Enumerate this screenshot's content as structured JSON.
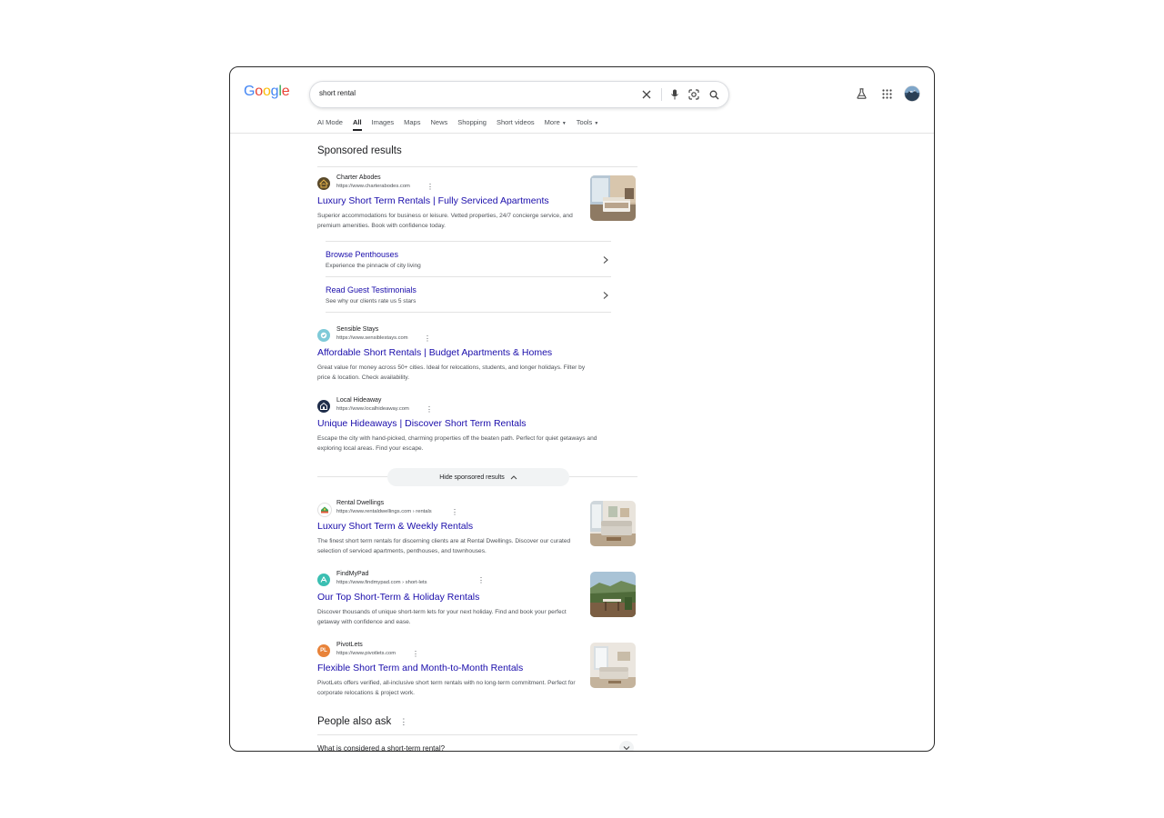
{
  "search": {
    "query": "short rental"
  },
  "logo": {
    "letters": [
      "G",
      "o",
      "o",
      "g",
      "l",
      "e"
    ],
    "colors": [
      "#4285F4",
      "#EA4335",
      "#FBBC05",
      "#4285F4",
      "#34A853",
      "#EA4335"
    ]
  },
  "tabs": [
    {
      "label": "AI Mode"
    },
    {
      "label": "All",
      "active": true
    },
    {
      "label": "Images"
    },
    {
      "label": "Maps"
    },
    {
      "label": "News"
    },
    {
      "label": "Shopping"
    },
    {
      "label": "Short videos"
    },
    {
      "label": "More"
    },
    {
      "label": "Tools"
    }
  ],
  "icons": {
    "clear": "close-icon",
    "voice": "microphone-icon",
    "lens": "camera-lens-icon",
    "search": "search-icon",
    "labs": "flask-icon",
    "apps": "apps-grid-icon",
    "account": "avatar"
  },
  "sponsored": {
    "heading": "Sponsored results",
    "ads": [
      {
        "site": "Charter Abodes",
        "url": "https://www.charterabodes.com",
        "title": "Luxury Short Term Rentals | Fully Serviced Apartments",
        "snippet": "Superior accommodations for business or leisure. Vetted properties, 24/7 concierge service, and premium amenities. Book with confidence today.",
        "sublinks": [
          {
            "title": "Browse Penthouses",
            "desc": "Experience the pinnacle of city living"
          },
          {
            "title": "Read Guest Testimonials",
            "desc": "See why our clients rate us 5 stars"
          }
        ]
      },
      {
        "site": "Sensible Stays",
        "url": "https://www.sensiblestays.com",
        "title": "Affordable Short Rentals | Budget Apartments & Homes",
        "snippet": "Great value for money across 50+ cities. Ideal for relocations, students, and longer holidays. Filter by price & location. Check availability."
      },
      {
        "site": "Local Hideaway",
        "url": "https://www.localhideaway.com",
        "title": "Unique Hideaways | Discover Short Term Rentals",
        "snippet": "Escape the city with hand-picked, charming properties off the beaten path. Perfect for quiet getaways and exploring local areas. Find your escape."
      }
    ],
    "hide_label": "Hide sponsored results"
  },
  "organic": [
    {
      "site": "Rental Dwellings",
      "url": "https://www.rentaldwellings.com › rentals",
      "title": "Luxury Short Term & Weekly Rentals",
      "snippet": "The finest short term rentals for discerning clients are at Rental Dwellings. Discover our curated selection of serviced apartments, penthouses, and townhouses."
    },
    {
      "site": "FindMyPad",
      "url": "https://www.findmypad.com › short-lets",
      "title": "Our Top Short-Term & Holiday Rentals",
      "snippet": "Discover thousands of unique short-term lets for your next holiday. Find and book your perfect getaway with confidence and ease."
    },
    {
      "site": "PivotLets",
      "url": "https://www.pivotlets.com",
      "title": "Flexible Short Term and Month-to-Month Rentals",
      "snippet": "PivotLets offers verified, all-inclusive short term rentals with no long-term commitment. Perfect for corporate relocations & project work.",
      "favicon_text": "PL"
    }
  ],
  "people_also_ask": {
    "heading": "People also ask",
    "questions": [
      "What is considered a short-term rental?"
    ]
  }
}
